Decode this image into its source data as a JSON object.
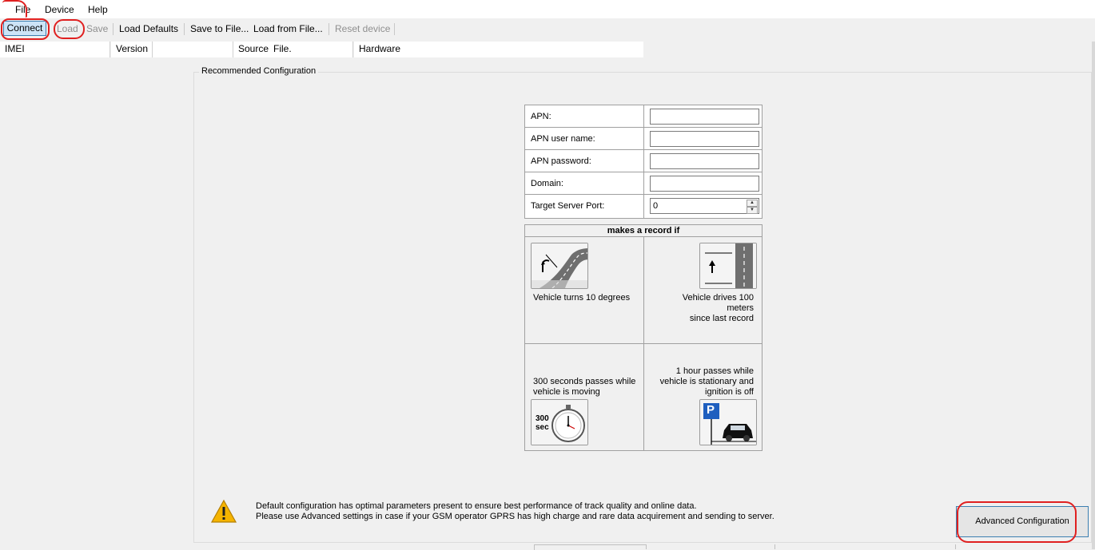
{
  "menu": {
    "file": "File",
    "device": "Device",
    "help": "Help"
  },
  "toolbar": {
    "connect": "Connect",
    "load": "Load",
    "save": "Save",
    "load_defaults": "Load Defaults",
    "save_to_file": "Save to File...",
    "load_from_file": "Load from File...",
    "reset_device": "Reset device"
  },
  "infobar": {
    "imei": "IMEI",
    "version": "Version",
    "source": "Source",
    "source_value": "File.",
    "hardware": "Hardware"
  },
  "group": {
    "title": "Recommended Configuration"
  },
  "form": {
    "apn_label": "APN:",
    "apn_value": "",
    "apn_user_label": "APN user name:",
    "apn_user_value": "",
    "apn_password_label": "APN password:",
    "apn_password_value": "",
    "domain_label": "Domain:",
    "domain_value": "",
    "port_label": "Target Server Port:",
    "port_value": "0"
  },
  "records": {
    "title": "makes a record if",
    "turn": "Vehicle turns 10 degrees",
    "distance_line1": "Vehicle drives 100 meters",
    "distance_line2": "since last record",
    "moving_line1": "300 seconds passes while",
    "moving_line2": "vehicle is moving",
    "stationary_line1": "1 hour passes while",
    "stationary_line2": "vehicle is stationary and",
    "stationary_line3": "ignition is off",
    "timer_icon_text_1": "300",
    "timer_icon_text_2": "sec",
    "parking_icon_text": "P"
  },
  "warning": {
    "line1": "Default configuration has optimal parameters present to ensure best performance of track quality and online data.",
    "line2": "Please use Advanced settings in case if your GSM operator GPRS has high charge and rare data acquirement and sending to server."
  },
  "advanced_button": "Advanced Configuration",
  "colors": {
    "highlight_ring": "#e02020",
    "button_focus": "#3c7fb1",
    "connect_bg": "#cce4f7",
    "warning_yellow": "#f5b400"
  }
}
